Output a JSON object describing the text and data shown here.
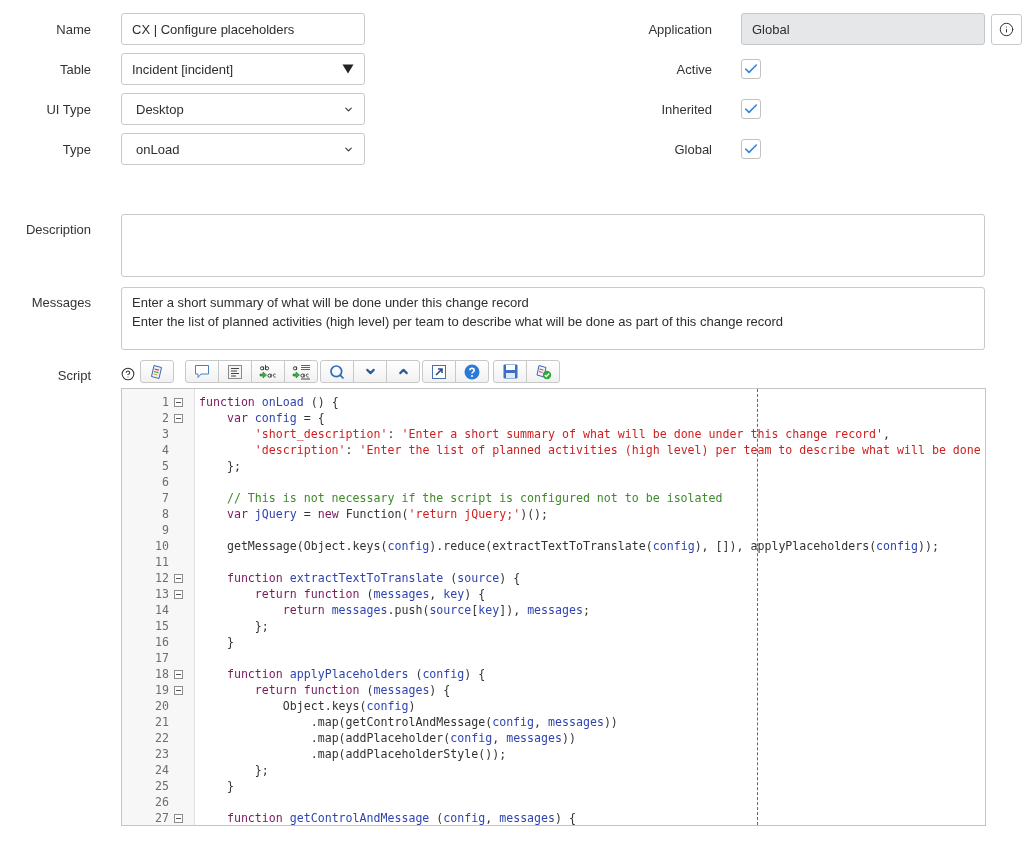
{
  "left_fields": [
    {
      "label": "Name",
      "kind": "text",
      "value": "CX | Configure placeholders"
    },
    {
      "label": "Table",
      "kind": "reference",
      "value": "Incident [incident]"
    },
    {
      "label": "UI Type",
      "kind": "select",
      "value": "Desktop"
    },
    {
      "label": "Type",
      "kind": "select",
      "value": "onLoad"
    }
  ],
  "right_fields": [
    {
      "label": "Application",
      "kind": "readonly",
      "value": "Global"
    },
    {
      "label": "Active",
      "kind": "checkbox",
      "checked": true
    },
    {
      "label": "Inherited",
      "kind": "checkbox",
      "checked": true
    },
    {
      "label": "Global",
      "kind": "checkbox",
      "checked": true
    }
  ],
  "description": {
    "label": "Description"
  },
  "messages": {
    "label": "Messages",
    "lines": [
      "Enter a short summary of what will be done under this change record",
      "Enter the list of planned activities (high level) per team to describe what will be done as part of this change record"
    ]
  },
  "script": {
    "label": "Script",
    "lines": [
      {
        "number": "1",
        "foldable": true,
        "tokens": [
          {
            "kind": "keyword",
            "text": "function"
          },
          {
            "kind": "def",
            "text": " onLoad"
          },
          {
            "kind": "plain",
            "text": " () {"
          }
        ]
      },
      {
        "number": "2",
        "foldable": true,
        "tokens": [
          {
            "kind": "keyword",
            "text": "    var"
          },
          {
            "kind": "def",
            "text": " config"
          },
          {
            "kind": "plain",
            "text": " = {"
          }
        ]
      },
      {
        "number": "3",
        "foldable": false,
        "tokens": [
          {
            "kind": "string",
            "text": "        'short_description'"
          },
          {
            "kind": "plain",
            "text": ": "
          },
          {
            "kind": "string",
            "text": "'Enter a short summary of what will be done under this change record'"
          },
          {
            "kind": "plain",
            "text": ","
          }
        ]
      },
      {
        "number": "4",
        "foldable": false,
        "tokens": [
          {
            "kind": "string",
            "text": "        'description'"
          },
          {
            "kind": "plain",
            "text": ": "
          },
          {
            "kind": "string",
            "text": "'Enter the list of planned activities (high level) per team to describe what will be done"
          }
        ]
      },
      {
        "number": "5",
        "foldable": false,
        "tokens": [
          {
            "kind": "plain",
            "text": "    };"
          }
        ]
      },
      {
        "number": "6",
        "foldable": false
      },
      {
        "number": "7",
        "foldable": false,
        "tokens": [
          {
            "kind": "comment",
            "text": "    // This is not necessary if the script is configured not to be isolated"
          }
        ]
      },
      {
        "number": "8",
        "foldable": false,
        "tokens": [
          {
            "kind": "keyword",
            "text": "    var"
          },
          {
            "kind": "def",
            "text": " jQuery"
          },
          {
            "kind": "plain",
            "text": " = "
          },
          {
            "kind": "keyword",
            "text": "new"
          },
          {
            "kind": "plain",
            "text": " Function("
          },
          {
            "kind": "string",
            "text": "'return jQuery;'"
          },
          {
            "kind": "plain",
            "text": ")();"
          }
        ]
      },
      {
        "number": "9",
        "foldable": false
      },
      {
        "number": "10",
        "foldable": false,
        "tokens": [
          {
            "kind": "plain",
            "text": "    getMessage(Object.keys("
          },
          {
            "kind": "def",
            "text": "config"
          },
          {
            "kind": "plain",
            "text": ").reduce(extractTextToTranslate("
          },
          {
            "kind": "def",
            "text": "config"
          },
          {
            "kind": "plain",
            "text": "), []), applyPlaceholders("
          },
          {
            "kind": "def",
            "text": "config"
          },
          {
            "kind": "plain",
            "text": "));"
          }
        ]
      },
      {
        "number": "11",
        "foldable": false
      },
      {
        "number": "12",
        "foldable": true,
        "tokens": [
          {
            "kind": "keyword",
            "text": "    function"
          },
          {
            "kind": "def",
            "text": " extractTextToTranslate"
          },
          {
            "kind": "plain",
            "text": " ("
          },
          {
            "kind": "def",
            "text": "source"
          },
          {
            "kind": "plain",
            "text": ") {"
          }
        ]
      },
      {
        "number": "13",
        "foldable": true,
        "tokens": [
          {
            "kind": "keyword",
            "text": "        return function"
          },
          {
            "kind": "plain",
            "text": " ("
          },
          {
            "kind": "def",
            "text": "messages"
          },
          {
            "kind": "plain",
            "text": ", "
          },
          {
            "kind": "def",
            "text": "key"
          },
          {
            "kind": "plain",
            "text": ") {"
          }
        ]
      },
      {
        "number": "14",
        "foldable": false,
        "tokens": [
          {
            "kind": "keyword",
            "text": "            return"
          },
          {
            "kind": "def",
            "text": " messages"
          },
          {
            "kind": "plain",
            "text": ".push("
          },
          {
            "kind": "def",
            "text": "source"
          },
          {
            "kind": "plain",
            "text": "["
          },
          {
            "kind": "def",
            "text": "key"
          },
          {
            "kind": "plain",
            "text": "]), "
          },
          {
            "kind": "def",
            "text": "messages"
          },
          {
            "kind": "plain",
            "text": ";"
          }
        ]
      },
      {
        "number": "15",
        "foldable": false,
        "tokens": [
          {
            "kind": "plain",
            "text": "        };"
          }
        ]
      },
      {
        "number": "16",
        "foldable": false,
        "tokens": [
          {
            "kind": "plain",
            "text": "    }"
          }
        ]
      },
      {
        "number": "17",
        "foldable": false
      },
      {
        "number": "18",
        "foldable": true,
        "tokens": [
          {
            "kind": "keyword",
            "text": "    function"
          },
          {
            "kind": "def",
            "text": " applyPlaceholders"
          },
          {
            "kind": "plain",
            "text": " ("
          },
          {
            "kind": "def",
            "text": "config"
          },
          {
            "kind": "plain",
            "text": ") {"
          }
        ]
      },
      {
        "number": "19",
        "foldable": true,
        "tokens": [
          {
            "kind": "keyword",
            "text": "        return function"
          },
          {
            "kind": "plain",
            "text": " ("
          },
          {
            "kind": "def",
            "text": "messages"
          },
          {
            "kind": "plain",
            "text": ") {"
          }
        ]
      },
      {
        "number": "20",
        "foldable": false,
        "tokens": [
          {
            "kind": "plain",
            "text": "            Object.keys("
          },
          {
            "kind": "def",
            "text": "config"
          },
          {
            "kind": "plain",
            "text": ")"
          }
        ]
      },
      {
        "number": "21",
        "foldable": false,
        "tokens": [
          {
            "kind": "plain",
            "text": "                .map(getControlAndMessage("
          },
          {
            "kind": "def",
            "text": "config"
          },
          {
            "kind": "plain",
            "text": ", "
          },
          {
            "kind": "def",
            "text": "messages"
          },
          {
            "kind": "plain",
            "text": "))"
          }
        ]
      },
      {
        "number": "22",
        "foldable": false,
        "tokens": [
          {
            "kind": "plain",
            "text": "                .map(addPlaceholder("
          },
          {
            "kind": "def",
            "text": "config"
          },
          {
            "kind": "plain",
            "text": ", "
          },
          {
            "kind": "def",
            "text": "messages"
          },
          {
            "kind": "plain",
            "text": "))"
          }
        ]
      },
      {
        "number": "23",
        "foldable": false,
        "tokens": [
          {
            "kind": "plain",
            "text": "                .map(addPlaceholderStyle());"
          }
        ]
      },
      {
        "number": "24",
        "foldable": false,
        "tokens": [
          {
            "kind": "plain",
            "text": "        };"
          }
        ]
      },
      {
        "number": "25",
        "foldable": false,
        "tokens": [
          {
            "kind": "plain",
            "text": "    }"
          }
        ]
      },
      {
        "number": "26",
        "foldable": false
      },
      {
        "number": "27",
        "foldable": true,
        "tokens": [
          {
            "kind": "keyword",
            "text": "    function"
          },
          {
            "kind": "def",
            "text": " getControlAndMessage"
          },
          {
            "kind": "plain",
            "text": " ("
          },
          {
            "kind": "def",
            "text": "config"
          },
          {
            "kind": "plain",
            "text": ", "
          },
          {
            "kind": "def",
            "text": "messages"
          },
          {
            "kind": "plain",
            "text": ") {"
          }
        ]
      }
    ]
  }
}
